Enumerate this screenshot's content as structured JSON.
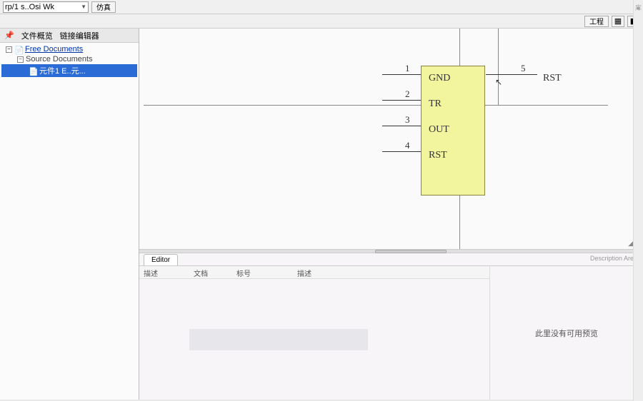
{
  "toolbar": {
    "dropdown_value": "rp/1 s..Osi Wk",
    "btn1": "仿真"
  },
  "panel": {
    "tab1": "文件概览",
    "tab2": "链接编辑器"
  },
  "tree": {
    "root": "Free Documents",
    "child1": "Source Documents",
    "child2": "元件1 E..元..."
  },
  "schematic": {
    "pins": {
      "p1": {
        "num": "1",
        "label": "GND"
      },
      "p2": {
        "num": "2",
        "label": "TR"
      },
      "p3": {
        "num": "3",
        "label": "OUT"
      },
      "p4": {
        "num": "4",
        "label": "RST"
      },
      "p5": {
        "num": "5",
        "label": "RST"
      }
    }
  },
  "bottom": {
    "tab_label": "Editor",
    "right_label": "Description Area",
    "col1": "描述",
    "col2": "文档",
    "col3": "标号",
    "col4": "描述",
    "no_preview": "此里没有可用预览"
  }
}
